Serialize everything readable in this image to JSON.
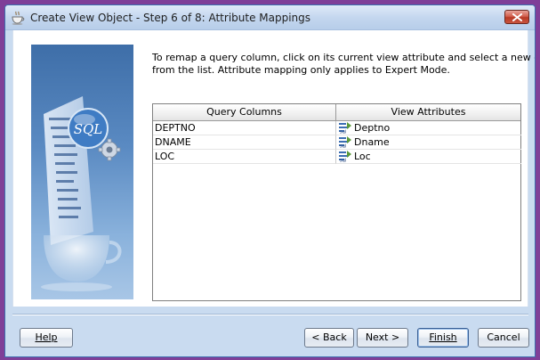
{
  "window": {
    "title": "Create View Object - Step 6 of 8: Attribute Mappings"
  },
  "instructions": {
    "line1": "To remap a query column, click on its current view attribute and select a new one",
    "line2": "from the list.  Attribute mapping only applies to Expert Mode."
  },
  "side_panel": {
    "badge_text": "SQL"
  },
  "table": {
    "columns": [
      "Query Columns",
      "View Attributes"
    ],
    "rows": [
      {
        "query_column": "DEPTNO",
        "view_attribute": "Deptno",
        "icon": "attribute-icon"
      },
      {
        "query_column": "DNAME",
        "view_attribute": "Dname",
        "icon": "attribute-icon"
      },
      {
        "query_column": "LOC",
        "view_attribute": "Loc",
        "icon": "attribute-icon"
      }
    ]
  },
  "buttons": {
    "help": "Help",
    "back": "< Back",
    "next": "Next >",
    "finish": "Finish",
    "cancel": "Cancel"
  },
  "icons": {
    "app": "coffee-cup-icon",
    "close": "close-icon"
  },
  "colors": {
    "window_border": "#7f3f98",
    "title_bar": "#c4d7ef",
    "close_button": "#c9553f",
    "side_panel": "#5a8ac2"
  }
}
